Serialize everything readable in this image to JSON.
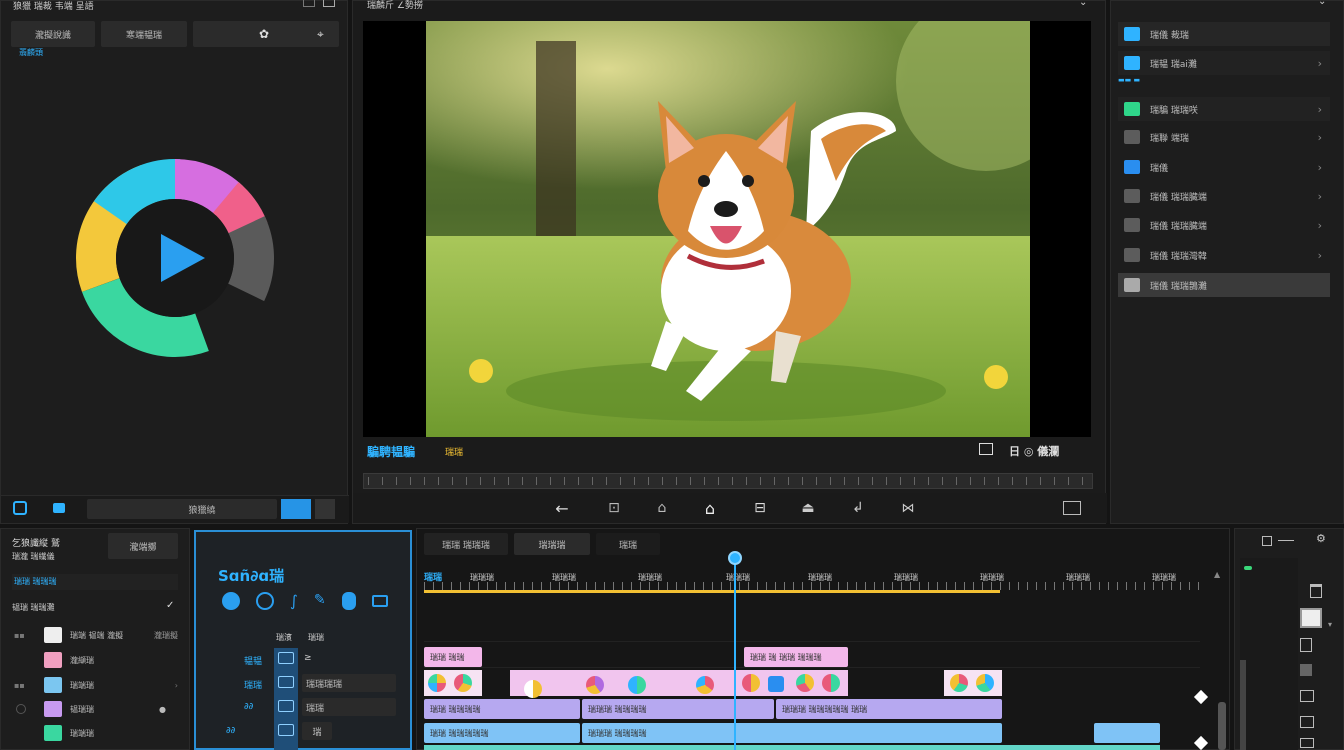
{
  "left_panel": {
    "title": "狼獵 瑞裁 韦端 呈語",
    "tabs": [
      "瀧擬說識",
      "寒端韫瑞",
      "✿",
      "⌖"
    ],
    "sub_label": "翡麟頭",
    "bottom_bar_label": "狼獵繞"
  },
  "preview": {
    "title": "瑞麟斤 ∠勢撈",
    "caption_left": "騙騁韫騙",
    "caption_tag": "瑞瑞",
    "caption_right": "日 ◎ 儀瀾",
    "controls": [
      "←",
      "⊡",
      "⌂",
      "⌂",
      "⊟",
      "⏏",
      "↲",
      "⋈"
    ]
  },
  "right_menu": {
    "items": [
      {
        "label": "瑞儀 裁瑞",
        "chev": "",
        "highlight": false
      },
      {
        "label": "瑞韫 瑞ai灘",
        "chev": "›",
        "highlight": false
      },
      {
        "label": "瑞騙 瑞瑞咲",
        "chev": "›",
        "highlight": false
      },
      {
        "label": "瑞聯 端瑞",
        "chev": "›",
        "highlight": false
      },
      {
        "label": "瑞儀",
        "chev": "›",
        "highlight": false
      },
      {
        "label": "瑞儀 瑞瑞臓端",
        "chev": "›",
        "highlight": false
      },
      {
        "label": "瑞儀 瑞瑞臓端",
        "chev": "›",
        "highlight": false
      },
      {
        "label": "瑞儀 瑞瑞灣韓",
        "chev": "›",
        "highlight": false
      },
      {
        "label": "瑞儀 瑞瑞鵲灘",
        "chev": "",
        "highlight": true
      }
    ]
  },
  "bottom_left": {
    "header": "乞狼讖縦 鷲",
    "header_btn": "瀧端擲",
    "sub": "瑞瀧 瑞繊儀",
    "section": "韫瑞 瑞瑞灘",
    "rows": [
      "瑞端 韫端 瀧擬",
      "瀧纈瑞",
      "瑞端瑞",
      "韫瑞瑞",
      "瑞端瑞"
    ],
    "row_tag": "瀧瑞擬"
  },
  "effects_panel": {
    "title": "Sɑñ∂ɑ瑞",
    "col_a": "瑞濱",
    "col_b": "瑞瑞",
    "rows": [
      {
        "left": "韫韫",
        "right": "≥"
      },
      {
        "left": "瑞瑞",
        "right": "瑞瑞瑞瑞"
      },
      {
        "left": "∂∂",
        "right": "瑞瑞"
      },
      {
        "left": "∂∂",
        "right": "瑞"
      }
    ]
  },
  "timeline": {
    "tabs": [
      "瑞瑞 瑞瑞瑞",
      "瑞瑞瑞",
      "瑞瑞"
    ],
    "ruler_start": "瑞瑞",
    "ruler": [
      "瑞瑞瑞",
      "瑞瑞瑞",
      "瑞瑞瑞",
      "瑞瑞瑞",
      "瑞瑞瑞",
      "瑞瑞瑞",
      "瑞瑞瑞",
      "瑞瑞瑞",
      "瑞瑞瑞"
    ],
    "title_clip_a": "瑞瑞 瑞瑞",
    "title_clip_b": "瑞瑞 瑞 瑞瑞 瑞瑞瑞",
    "track_a": [
      "瑞瑞 瑞瑞瑞瑞",
      "瑞瑞瑞 瑞瑞瑞瑞",
      "瑞瑞瑞 瑞瑞瑞瑞瑞 瑞瑞"
    ],
    "track_b": [
      "瑞瑞 瑞瑞瑞瑞瑞",
      "瑞瑞瑞 瑞瑞瑞瑞"
    ]
  },
  "colors": {
    "accent": "#2fb3ff",
    "yellow": "#f2c033",
    "pink_clip": "#f3b7ea",
    "lavender_clip": "#b6a8f0",
    "blue_clip": "#7fc3f6"
  }
}
